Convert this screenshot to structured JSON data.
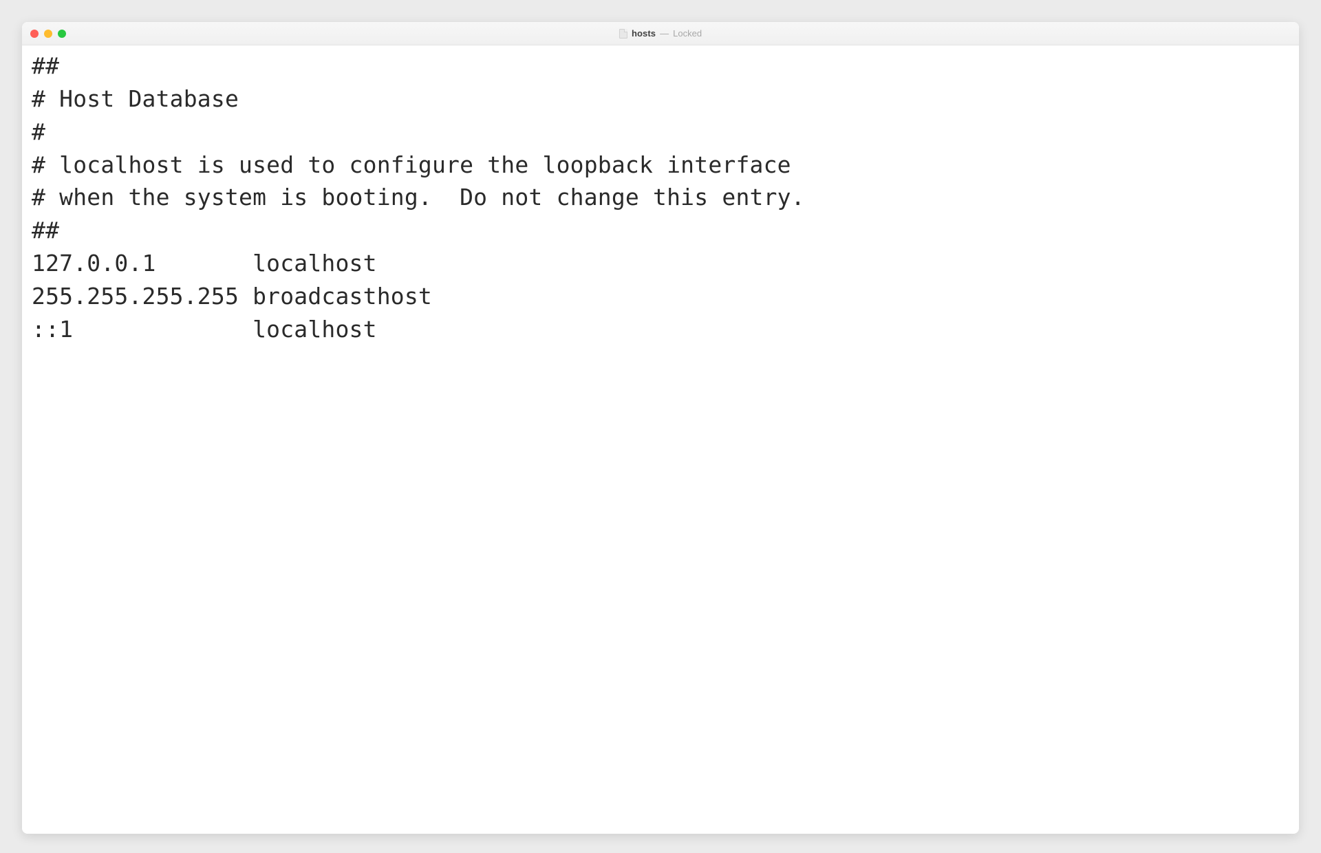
{
  "titlebar": {
    "filename": "hosts",
    "separator": "—",
    "status": "Locked"
  },
  "file": {
    "lines": [
      "##",
      "# Host Database",
      "#",
      "# localhost is used to configure the loopback interface",
      "# when the system is booting.  Do not change this entry.",
      "##",
      "127.0.0.1       localhost",
      "255.255.255.255 broadcasthost",
      "::1             localhost"
    ]
  }
}
